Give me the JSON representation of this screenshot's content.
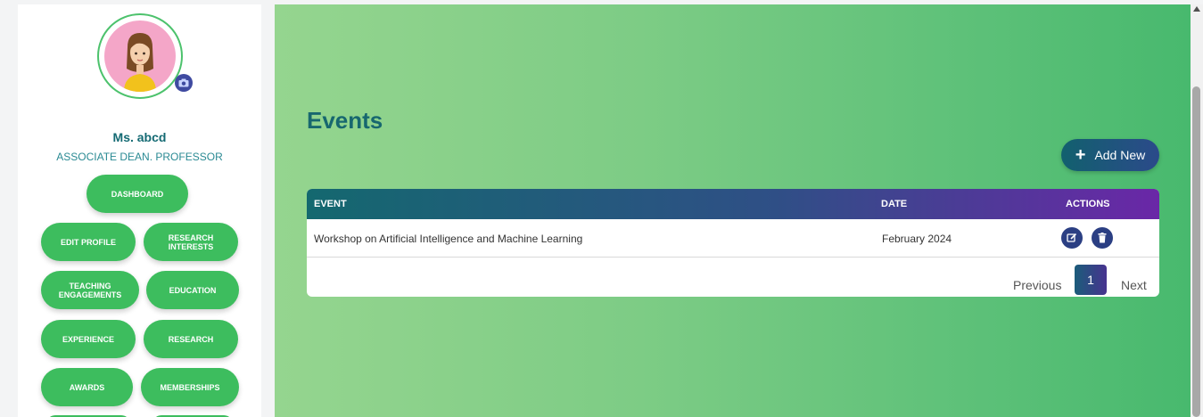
{
  "profile": {
    "name": "Ms. abcd",
    "role": "ASSOCIATE DEAN. PROFESSOR"
  },
  "nav": {
    "dashboard": "DASHBOARD",
    "edit_profile": "EDIT PROFILE",
    "research_interests": "RESEARCH INTERESTS",
    "teaching_engagements": "TEACHING ENGAGEMENTS",
    "education": "EDUCATION",
    "experience": "EXPERIENCE",
    "research": "RESEARCH",
    "awards": "AWARDS",
    "memberships": "MEMBERSHIPS"
  },
  "main": {
    "title": "Events",
    "add_label": "Add New",
    "table": {
      "headers": {
        "event": "EVENT",
        "date": "DATE",
        "actions": "ACTIONS"
      },
      "rows": [
        {
          "event": "Workshop on Artificial Intelligence and Machine Learning",
          "date": "February 2024"
        }
      ]
    },
    "pagination": {
      "previous": "Previous",
      "current": "1",
      "next": "Next"
    }
  },
  "icons": {
    "camera": "camera-icon",
    "plus": "plus-icon",
    "edit": "edit-icon",
    "delete": "trash-icon"
  },
  "colors": {
    "accent_green": "#3dbd5e",
    "title_teal": "#17676f",
    "action_navy": "#2b3f83"
  }
}
